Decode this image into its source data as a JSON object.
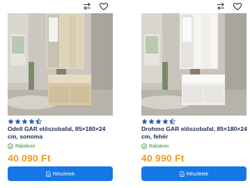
{
  "products": [
    {
      "id_label": "product-1",
      "title": "Odell GAR előszobafal, 85×180×24 cm, sonoma",
      "rating": 4.5,
      "stock": "Raktáron",
      "price": "40 090 Ft",
      "button": "Részletek",
      "finish": "sonoma"
    },
    {
      "id_label": "product-2",
      "title": "Drohmo GAR előszobafal, 85×180×24 cm, fehér",
      "rating": 4.5,
      "stock": "Raktáron",
      "price": "40 990 Ft",
      "button": "Részletek",
      "finish": "white"
    }
  ],
  "icons": {
    "compare": "compare-arrows-icon",
    "favorite": "heart-outline-icon",
    "star": "star-icon",
    "stock": "check-circle-icon",
    "details": "document-icon"
  },
  "colors": {
    "title": "#1e2a55",
    "price": "#f29a1a",
    "stock": "#2f8a2f",
    "button": "#1677e6",
    "star": "#2a5bb8"
  }
}
